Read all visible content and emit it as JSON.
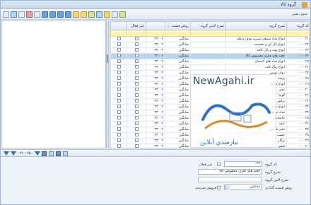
{
  "window": {
    "title": "گروه کالا"
  },
  "toolbar": {
    "menu_label": "منوی تغییر"
  },
  "grid": {
    "columns": [
      "کد گروه",
      "شرح گروه",
      "شرح لاتین گروه",
      "روش قیمت ...",
      "",
      "غیر فعال",
      ""
    ],
    "rows": [
      {
        "code": "۰۰۰۰۲۱",
        "name": "انواع مداد شمعی سیرید ووف و فلو",
        "method": "میانگین",
        "num": "۳۳۰۰۲"
      },
      {
        "code": "۰۰۰۰۲۲",
        "name": "انواع پاک کن و تقسیمه",
        "method": "میانگین",
        "num": "۳۳۰۰۲"
      },
      {
        "code": "۰۰۰۰۲۳",
        "name": "انواع پوند و پاک کاغذ",
        "method": "میانگین",
        "num": "۳۳۰۰۲"
      },
      {
        "code": "۰۰۰۰۲۴",
        "name": "جعبه های فلزی مخصوص کالا",
        "method": "میانگین",
        "num": "۳۳۰۰۲"
      },
      {
        "code": "۰۰۰۰۲۵",
        "name": "انواع مداد های لاستیک",
        "method": "میانگین",
        "num": "۳۳۰۰۲"
      },
      {
        "code": "۰۰۰۰۲۶",
        "name": "انواع رنگ پالت",
        "method": "میانگین",
        "num": "۳۳۰۰۲"
      },
      {
        "code": "۰۰۰۰۲۷",
        "name": "روان نویس",
        "method": "میانگین",
        "num": "۳۳۰۰۲"
      },
      {
        "code": "۰۰۰۰۲۸",
        "name": "پوشه",
        "method": "میانگین",
        "num": "۳۳۰۰۲"
      },
      {
        "code": "۰۰۰۰۲۹",
        "name": "انواع ماژیک",
        "method": "میانگین",
        "num": "۳۳۰۰۲"
      },
      {
        "code": "۰۰۰۰۳۰",
        "name": "دفتر",
        "method": "میانگین",
        "num": "۳۳۰۰۲"
      },
      {
        "code": "۰۰۰۰۳۱",
        "name": "گونیا",
        "method": "میانگین",
        "num": "۳۳۰۰۲"
      },
      {
        "code": "۰۰۰۰۳۲",
        "name": "تراش",
        "method": "میانگین",
        "num": "۳۳۰۰۲"
      },
      {
        "code": "۰۰۰۰۳۳",
        "name": "انواع تخته",
        "method": "میانگین",
        "num": "۳۳۰۰۲"
      },
      {
        "code": "۰۰۰۰۳۴",
        "name": "مداد تراش",
        "method": "میانگین",
        "num": "۳۳۰۰۲"
      },
      {
        "code": "۰۰۰۰۳۵",
        "name": "جامدادی",
        "method": "میانگین",
        "num": "۳۳۰۰۲"
      },
      {
        "code": "۰۰۰۰۳۶",
        "name": "کیف",
        "method": "میانگین",
        "num": "۳۳۰۰۲"
      },
      {
        "code": "۰۰۰۰۳۷",
        "name": "دفتر نقاشی",
        "method": "میانگین",
        "num": "۳۳۰۰۲"
      },
      {
        "code": "۰۰۰۰۳۸",
        "name": "چسب",
        "method": "میانگین",
        "num": "۳۳۰۰۲"
      },
      {
        "code": "۰۰۰۰۳۹",
        "name": "پرگار",
        "method": "میانگین",
        "num": "۳۳۰۰۲"
      },
      {
        "code": "۰۰۰۰۴۰",
        "name": "قیچی",
        "method": "میانگین",
        "num": "۳۳۰۰۲"
      }
    ]
  },
  "navbar": {
    "record_count": "۲۱ : ۲۵"
  },
  "form": {
    "code_label": "کد گروه",
    "code_value": "۰۰۰۰۲۴",
    "inactive_label": "غیر فعال",
    "name_label": "شرح گروه",
    "name_value": "جعبه های فلزی مخصوص کالا",
    "latin_label": "شرح لاتین گروه",
    "latin_value": "",
    "pricing_label": "روش قیمت گذاری",
    "pricing_value": "میانگین",
    "serial_label": "فروش سریدی"
  },
  "watermark": {
    "site": "NewAgahi.ir",
    "tagline": "نیازمندی آنلاین"
  },
  "icons": [
    "app-icon",
    "new-icon",
    "save-icon",
    "delete-icon",
    "print-icon",
    "filter-icon",
    "refresh-icon",
    "export-icon"
  ]
}
